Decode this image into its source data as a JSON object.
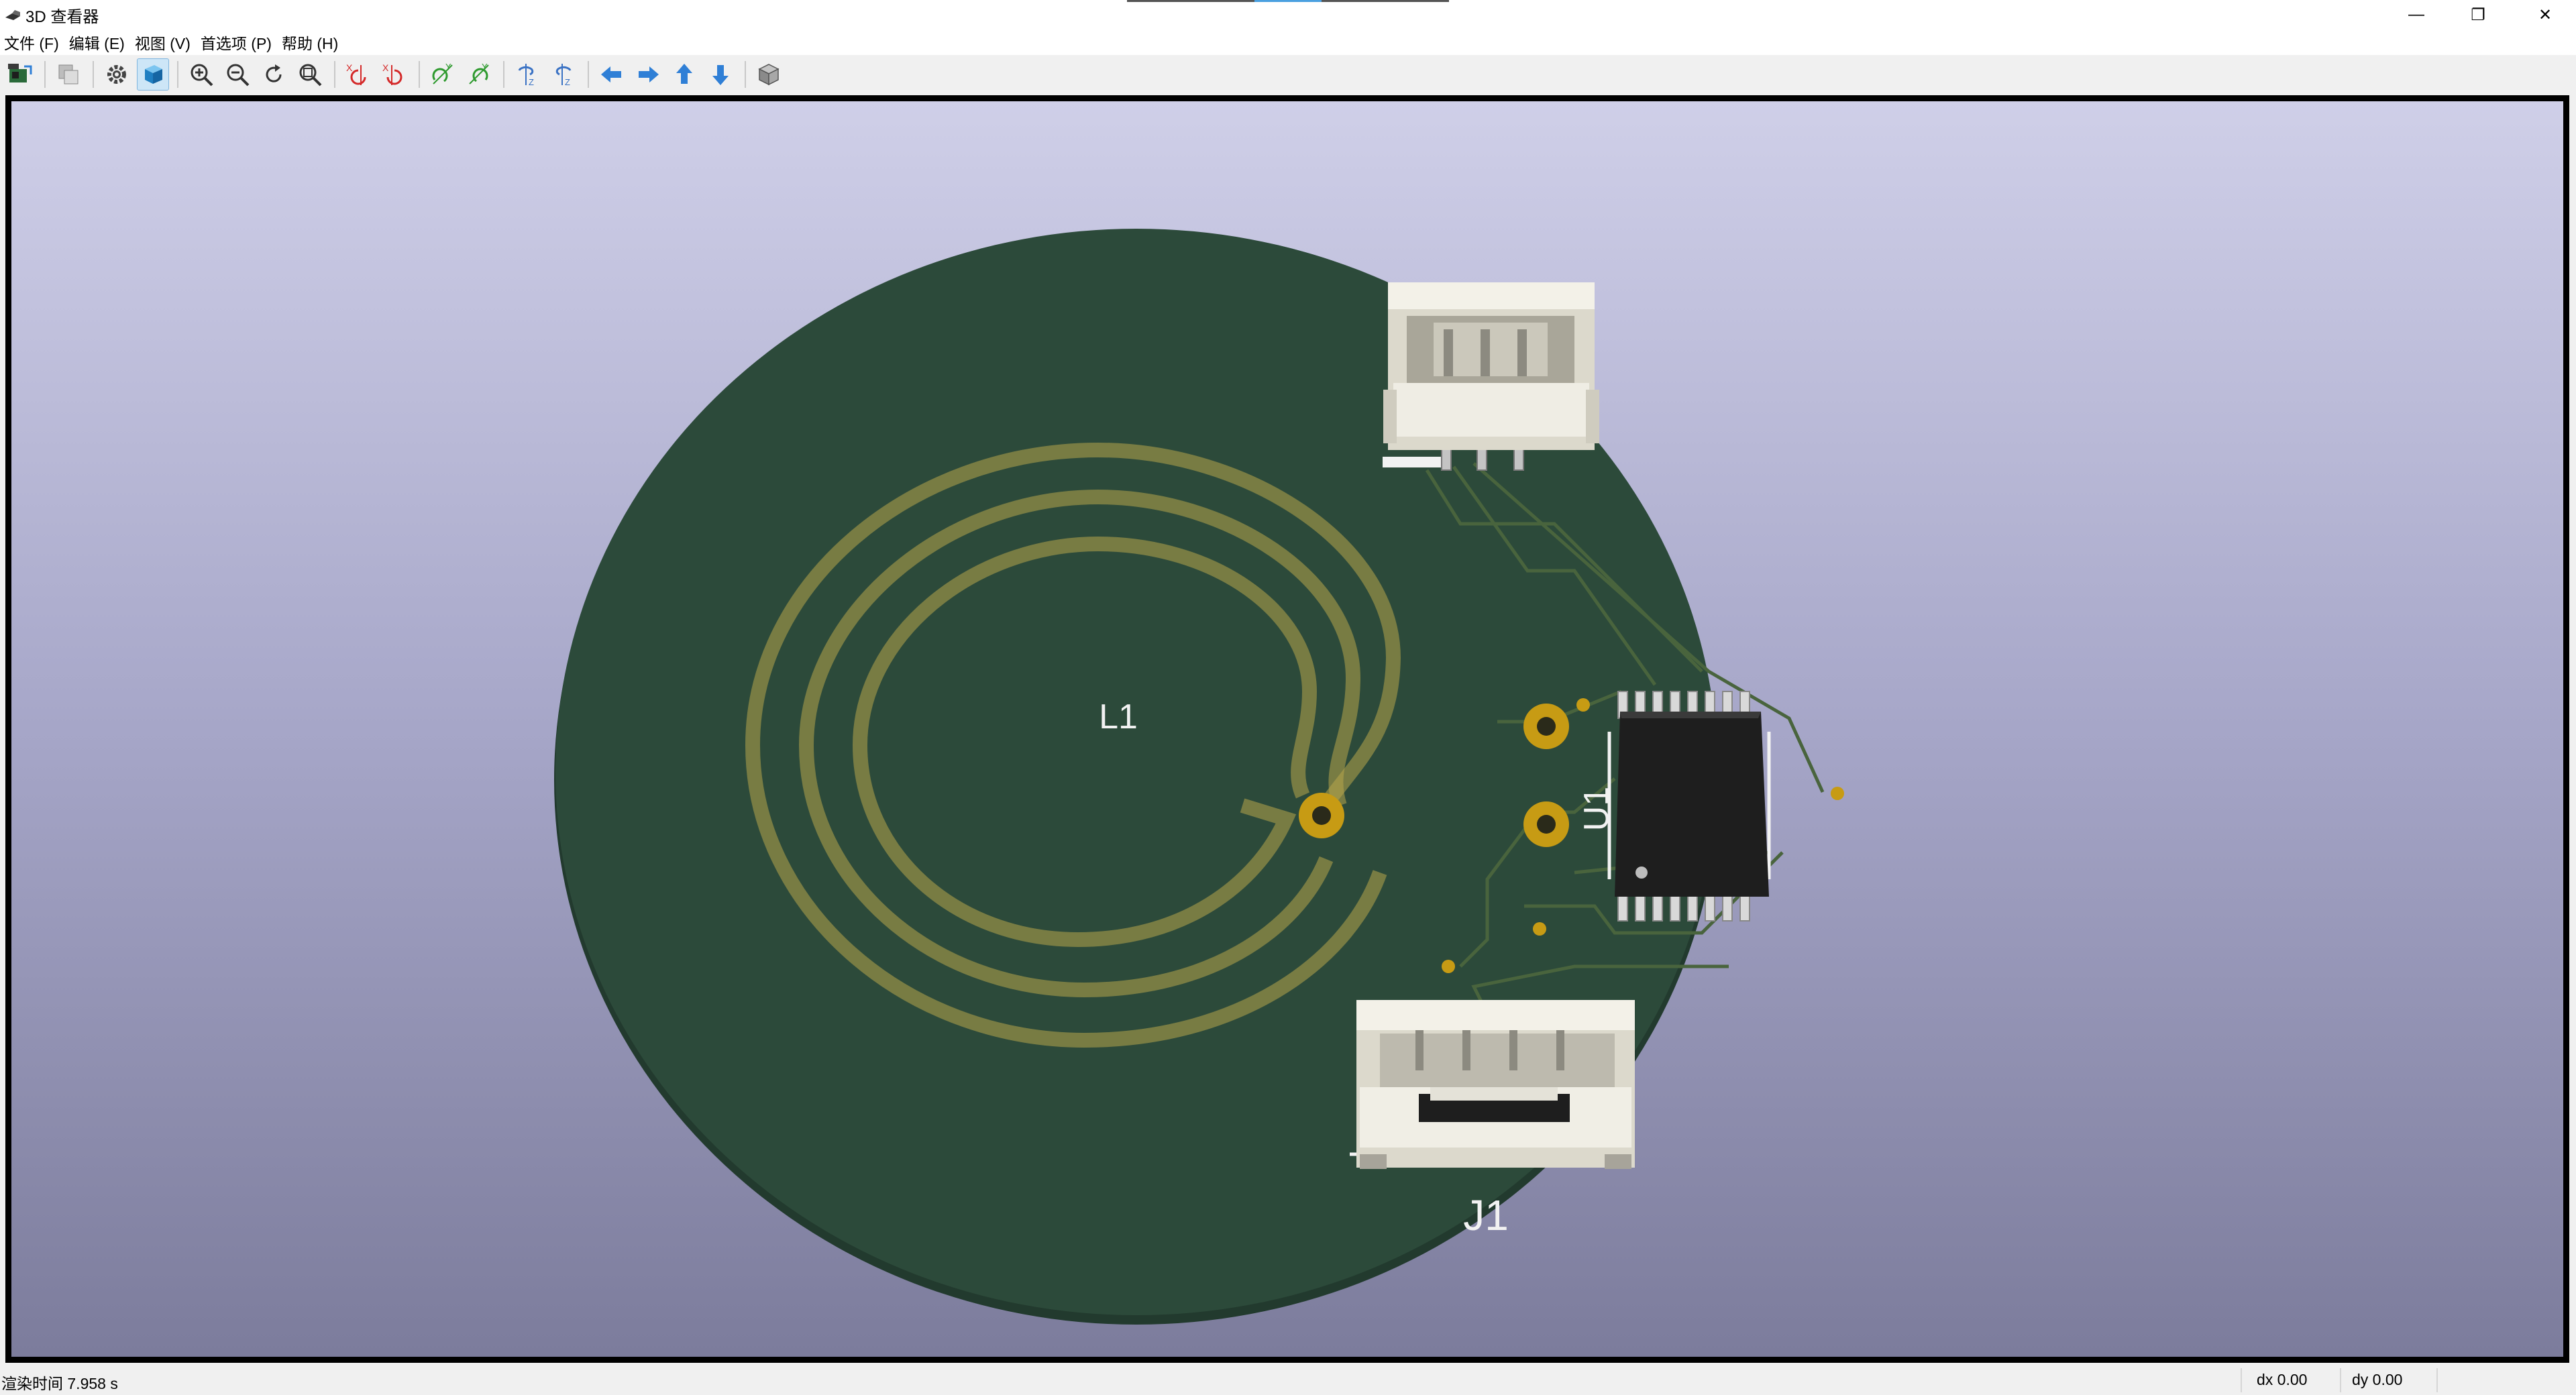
{
  "window": {
    "title": "3D 查看器",
    "minimize_glyph": "—",
    "restore_glyph": "❐",
    "close_glyph": "✕"
  },
  "menu": [
    {
      "label": "文件 (F)"
    },
    {
      "label": "编辑 (E)"
    },
    {
      "label": "视图 (V)"
    },
    {
      "label": "首选项 (P)"
    },
    {
      "label": "帮助 (H)"
    }
  ],
  "toolbar": {
    "items": [
      {
        "name": "reload-board-icon"
      },
      {
        "name": "copy-image-icon"
      },
      {
        "name": "render-options-icon"
      },
      {
        "name": "raytrace-render-icon",
        "active": true
      },
      {
        "name": "zoom-in-icon"
      },
      {
        "name": "zoom-out-icon"
      },
      {
        "name": "redraw-icon"
      },
      {
        "name": "zoom-fit-icon"
      },
      {
        "name": "rotate-x-cw-icon"
      },
      {
        "name": "rotate-x-ccw-icon"
      },
      {
        "name": "rotate-y-cw-icon"
      },
      {
        "name": "rotate-y-ccw-icon"
      },
      {
        "name": "rotate-z-cw-icon"
      },
      {
        "name": "rotate-z-ccw-icon"
      },
      {
        "name": "pan-left-icon"
      },
      {
        "name": "pan-right-icon"
      },
      {
        "name": "pan-up-icon"
      },
      {
        "name": "pan-down-icon"
      },
      {
        "name": "orthographic-toggle-icon"
      }
    ],
    "colors": {
      "rotate_x": "#d42a2a",
      "rotate_y": "#2e9a2e",
      "rotate_z": "#3a72c4",
      "pan": "#2f7fd6"
    }
  },
  "viewport": {
    "background_top": "#cfcfe8",
    "background_bottom": "#7c7c9c",
    "board_color": "#2c4a3a",
    "copper_color": "#c8b24a",
    "silk_color": "#f2f2f2",
    "labels": {
      "inductor": "L1",
      "ic": "U1",
      "connector": "J1"
    }
  },
  "status": {
    "render_time": "渲染时间 7.958 s",
    "dx": "dx 0.00",
    "dy": "dy 0.00"
  }
}
